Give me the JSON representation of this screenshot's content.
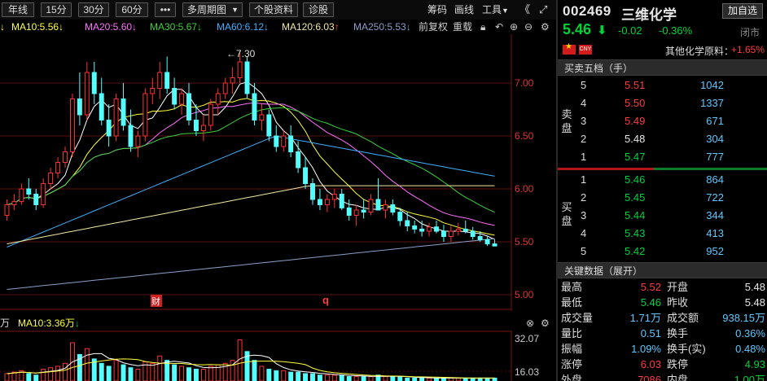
{
  "toolbar": {
    "periods": [
      "年线",
      "15分",
      "30分",
      "60分"
    ],
    "more": "•••",
    "multi_period": "多周期图",
    "stock_info": "个股资料",
    "diagnose": "诊股",
    "right_items": [
      "筹码",
      "画线",
      "工具"
    ]
  },
  "ma_row": {
    "items": [
      {
        "label": "MA10:5.56",
        "arrow": "↓",
        "color": "#ffff40"
      },
      {
        "label": "MA20:5.60",
        "arrow": "↓",
        "color": "#ff70ff"
      },
      {
        "label": "MA30:5.67",
        "arrow": "↓",
        "color": "#3cd23c"
      },
      {
        "label": "MA60:6.12",
        "arrow": "↓",
        "color": "#40b0ff"
      },
      {
        "label": "MA120:6.03",
        "arrow": "↑",
        "color": "#f0e8a0"
      },
      {
        "label": "MA250:5.53",
        "arrow": "↓",
        "color": "#8aa0c8"
      }
    ],
    "restore": "前复权",
    "overlay": "重载"
  },
  "main_chart": {
    "price_ticks": [
      "7.00",
      "6.50",
      "6.00",
      "5.50",
      "5.00"
    ],
    "high_annotation": "7.30",
    "markers": [
      "财",
      "q"
    ]
  },
  "volume": {
    "header_unit": "万",
    "ma_label": "MA10:3.36万",
    "ma_arrow": "↓",
    "ticks": [
      "32.07",
      "16.03"
    ]
  },
  "stock": {
    "code": "002469",
    "name": "三维化学",
    "add_watch": "加自选",
    "price": "5.46",
    "change": "-0.02",
    "change_pct": "-0.36%",
    "status": "闭市",
    "cny": "CNY",
    "sector": "其他化学原料：",
    "sector_pct": "+1.65%"
  },
  "orderbook": {
    "title": "买卖五档（手）",
    "sell_label": "卖盘",
    "buy_label": "买盘",
    "sell": [
      {
        "level": "5",
        "price": "5.51",
        "vol": "1042",
        "color": "red"
      },
      {
        "level": "4",
        "price": "5.50",
        "vol": "1337",
        "color": "red"
      },
      {
        "level": "3",
        "price": "5.49",
        "vol": "671",
        "color": "red"
      },
      {
        "level": "2",
        "price": "5.48",
        "vol": "304",
        "color": "white"
      },
      {
        "level": "1",
        "price": "5.47",
        "vol": "777",
        "color": "green"
      }
    ],
    "buy": [
      {
        "level": "1",
        "price": "5.46",
        "vol": "864",
        "color": "green"
      },
      {
        "level": "2",
        "price": "5.45",
        "vol": "722",
        "color": "green"
      },
      {
        "level": "3",
        "price": "5.44",
        "vol": "344",
        "color": "green"
      },
      {
        "level": "4",
        "price": "5.43",
        "vol": "413",
        "color": "green"
      },
      {
        "level": "5",
        "price": "5.42",
        "vol": "952",
        "color": "green"
      }
    ]
  },
  "keydata": {
    "title": "关键数据（展开）",
    "rows": [
      {
        "l1": "最高",
        "v1": "5.52",
        "c1": "red",
        "l2": "开盘",
        "v2": "5.48",
        "c2": "white"
      },
      {
        "l1": "最低",
        "v1": "5.46",
        "c1": "green",
        "l2": "昨收",
        "v2": "5.48",
        "c2": "white"
      },
      {
        "l1": "成交量",
        "v1": "1.71万",
        "c1": "cyan",
        "l2": "成交额",
        "v2": "938.15万",
        "c2": "cyan"
      },
      {
        "l1": "量比",
        "v1": "0.51",
        "c1": "cyan",
        "l2": "换手",
        "v2": "0.36%",
        "c2": "cyan"
      },
      {
        "l1": "振幅",
        "v1": "1.09%",
        "c1": "cyan",
        "l2": "换手(实)",
        "v2": "0.48%",
        "c2": "cyan"
      },
      {
        "l1": "涨停",
        "v1": "6.03",
        "c1": "red",
        "l2": "跌停",
        "v2": "4.93",
        "c2": "green"
      },
      {
        "l1": "外盘",
        "v1": "7086",
        "c1": "red",
        "l2": "内盘",
        "v2": "1.00万",
        "c2": "green"
      }
    ]
  },
  "chart_data": {
    "type": "candlestick",
    "y_range": [
      4.8,
      7.4
    ],
    "candles": [
      [
        5.75,
        5.9,
        5.7,
        5.85
      ],
      [
        5.85,
        5.95,
        5.8,
        5.88
      ],
      [
        5.88,
        6.05,
        5.85,
        6.0
      ],
      [
        6.0,
        6.1,
        5.9,
        5.95
      ],
      [
        5.95,
        6.0,
        5.8,
        5.85
      ],
      [
        5.85,
        6.1,
        5.82,
        6.05
      ],
      [
        6.05,
        6.2,
        6.0,
        6.15
      ],
      [
        6.15,
        6.3,
        6.1,
        6.25
      ],
      [
        6.25,
        6.4,
        6.2,
        6.35
      ],
      [
        6.35,
        6.9,
        6.3,
        6.85
      ],
      [
        6.85,
        7.1,
        6.6,
        6.7
      ],
      [
        6.7,
        7.2,
        6.65,
        7.1
      ],
      [
        7.1,
        7.2,
        6.8,
        6.9
      ],
      [
        6.9,
        7.05,
        6.6,
        6.65
      ],
      [
        6.65,
        6.8,
        6.4,
        6.5
      ],
      [
        6.5,
        6.9,
        6.45,
        6.85
      ],
      [
        6.85,
        7.0,
        6.55,
        6.6
      ],
      [
        6.6,
        6.75,
        6.35,
        6.4
      ],
      [
        6.4,
        6.55,
        6.3,
        6.5
      ],
      [
        6.5,
        6.95,
        6.45,
        6.9
      ],
      [
        6.9,
        7.05,
        6.8,
        6.95
      ],
      [
        6.95,
        7.2,
        6.85,
        7.1
      ],
      [
        7.1,
        7.25,
        6.9,
        6.95
      ],
      [
        6.95,
        7.05,
        6.75,
        6.8
      ],
      [
        6.8,
        6.95,
        6.7,
        6.9
      ],
      [
        6.9,
        7.0,
        6.6,
        6.65
      ],
      [
        6.65,
        6.8,
        6.5,
        6.55
      ],
      [
        6.55,
        6.7,
        6.45,
        6.6
      ],
      [
        6.6,
        6.85,
        6.55,
        6.8
      ],
      [
        6.8,
        6.95,
        6.7,
        6.9
      ],
      [
        6.9,
        7.05,
        6.85,
        7.0
      ],
      [
        7.0,
        7.15,
        6.9,
        7.05
      ],
      [
        7.05,
        7.3,
        7.0,
        7.2
      ],
      [
        7.2,
        7.25,
        6.85,
        6.9
      ],
      [
        6.9,
        7.0,
        6.6,
        6.65
      ],
      [
        6.65,
        6.8,
        6.55,
        6.7
      ],
      [
        6.7,
        6.75,
        6.45,
        6.5
      ],
      [
        6.5,
        6.6,
        6.35,
        6.4
      ],
      [
        6.4,
        6.55,
        6.35,
        6.5
      ],
      [
        6.5,
        6.6,
        6.3,
        6.35
      ],
      [
        6.35,
        6.45,
        6.15,
        6.2
      ],
      [
        6.2,
        6.3,
        6.0,
        6.05
      ],
      [
        6.05,
        6.1,
        5.85,
        5.9
      ],
      [
        5.9,
        6.0,
        5.8,
        5.85
      ],
      [
        5.85,
        5.95,
        5.78,
        5.9
      ],
      [
        5.9,
        6.0,
        5.82,
        5.95
      ],
      [
        5.95,
        6.0,
        5.8,
        5.82
      ],
      [
        5.82,
        5.9,
        5.7,
        5.75
      ],
      [
        5.75,
        5.85,
        5.65,
        5.8
      ],
      [
        5.8,
        5.9,
        5.72,
        5.78
      ],
      [
        5.78,
        5.95,
        5.75,
        5.9
      ],
      [
        5.9,
        6.1,
        5.85,
        5.8
      ],
      [
        5.8,
        5.9,
        5.72,
        5.85
      ],
      [
        5.85,
        5.9,
        5.75,
        5.78
      ],
      [
        5.78,
        5.82,
        5.65,
        5.7
      ],
      [
        5.7,
        5.78,
        5.6,
        5.65
      ],
      [
        5.65,
        5.7,
        5.58,
        5.62
      ],
      [
        5.62,
        5.7,
        5.55,
        5.6
      ],
      [
        5.6,
        5.68,
        5.55,
        5.64
      ],
      [
        5.64,
        5.7,
        5.58,
        5.6
      ],
      [
        5.6,
        5.66,
        5.5,
        5.55
      ],
      [
        5.55,
        5.65,
        5.5,
        5.6
      ],
      [
        5.6,
        5.68,
        5.56,
        5.62
      ],
      [
        5.62,
        5.7,
        5.58,
        5.6
      ],
      [
        5.6,
        5.64,
        5.52,
        5.55
      ],
      [
        5.55,
        5.6,
        5.5,
        5.52
      ],
      [
        5.52,
        5.56,
        5.46,
        5.48
      ],
      [
        5.48,
        5.52,
        5.46,
        5.46
      ]
    ],
    "volumes": [
      5,
      6,
      7,
      5,
      4,
      8,
      9,
      10,
      12,
      26,
      18,
      22,
      15,
      12,
      10,
      14,
      11,
      9,
      8,
      13,
      12,
      17,
      14,
      11,
      10,
      9,
      8,
      8,
      10,
      11,
      12,
      14,
      28,
      20,
      14,
      10,
      8,
      7,
      7,
      6,
      6,
      5,
      5,
      4,
      4,
      4,
      4,
      3,
      3,
      3,
      3,
      4,
      3,
      3,
      3,
      2,
      2,
      2,
      2,
      2,
      2,
      2,
      2,
      2,
      2,
      2,
      2,
      2
    ]
  }
}
